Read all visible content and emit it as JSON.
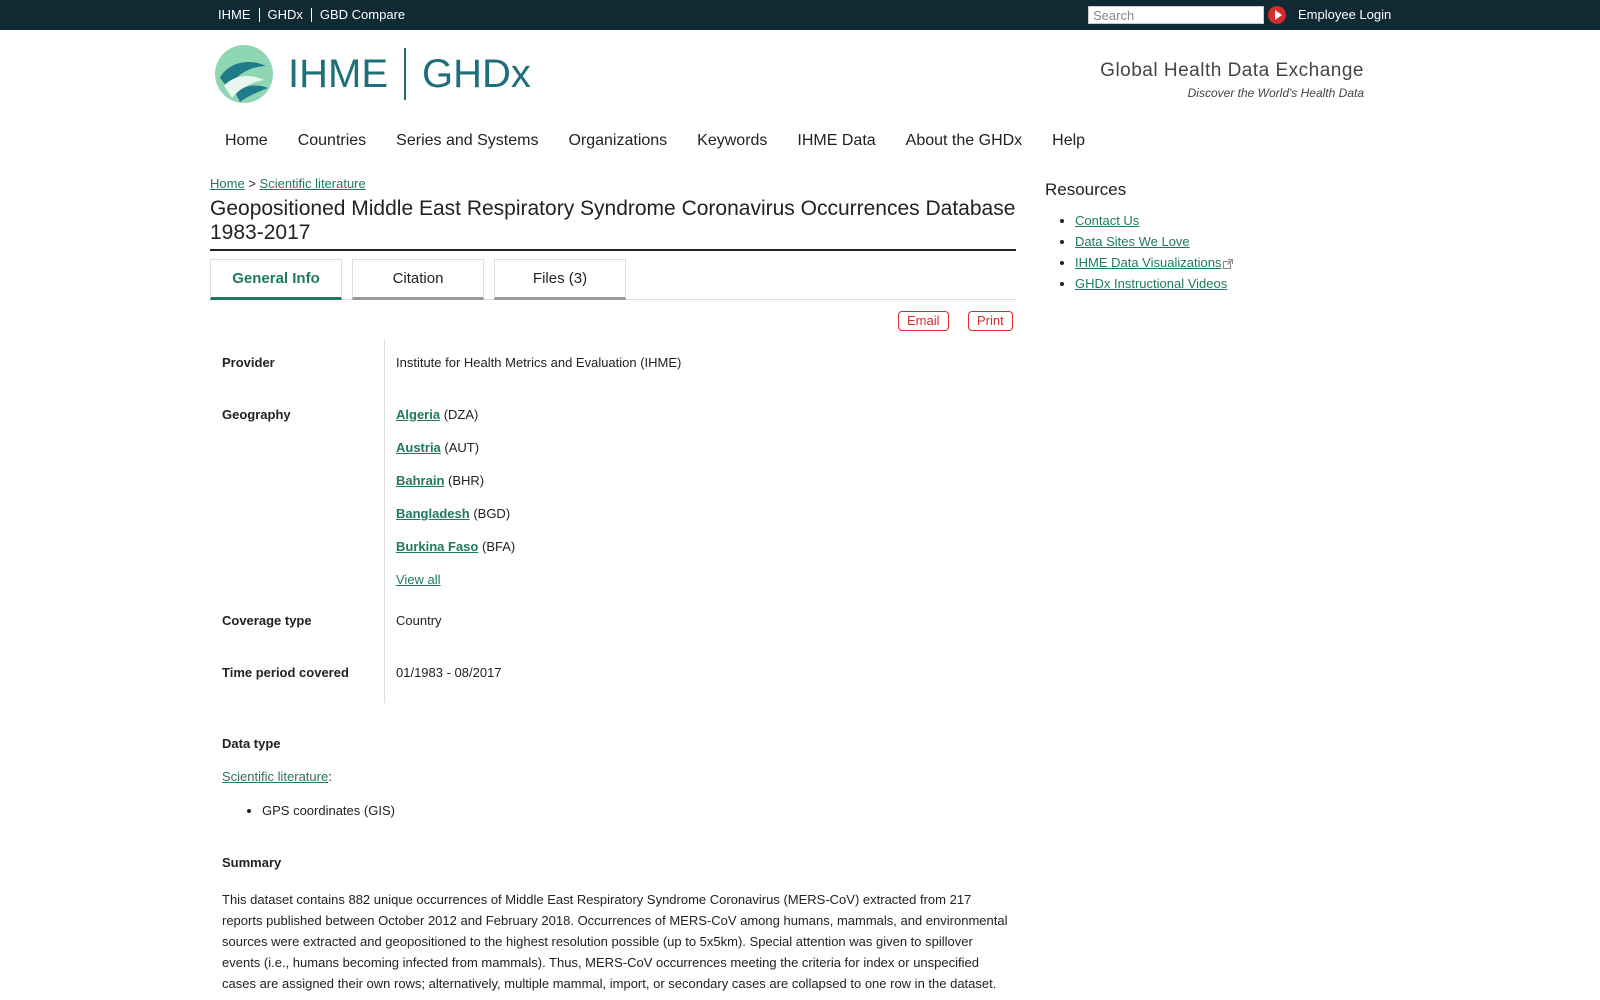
{
  "topnav": [
    "IHME",
    "GHDx",
    "GBD Compare"
  ],
  "search": {
    "placeholder": "Search"
  },
  "login_label": "Employee Login",
  "brand": {
    "ihme": "IHME",
    "ghdx": "GHDx",
    "tagline": "Global Health Data Exchange",
    "subtagline": "Discover the World's Health Data"
  },
  "mainnav": [
    "Home",
    "Countries",
    "Series and Systems",
    "Organizations",
    "Keywords",
    "IHME Data",
    "About the GHDx",
    "Help"
  ],
  "breadcrumb": {
    "home": "Home",
    "sep": ">",
    "current": "Scientific literature"
  },
  "title": "Geopositioned Middle East Respiratory Syndrome Coronavirus Occurrences Database 1983-2017",
  "tabs": [
    "General Info",
    "Citation",
    "Files (3)"
  ],
  "actions": {
    "email": "Email",
    "print": "Print"
  },
  "provider": {
    "label": "Provider",
    "value": "Institute for Health Metrics and Evaluation (IHME)"
  },
  "geography": {
    "label": "Geography",
    "items": [
      {
        "name": "Algeria",
        "code": "(DZA)"
      },
      {
        "name": "Austria",
        "code": "(AUT)"
      },
      {
        "name": "Bahrain",
        "code": "(BHR)"
      },
      {
        "name": "Bangladesh",
        "code": "(BGD)"
      },
      {
        "name": "Burkina Faso",
        "code": "(BFA)"
      }
    ],
    "view_all": "View all"
  },
  "coverage": {
    "label": "Coverage type",
    "value": "Country"
  },
  "time_period": {
    "label": "Time period covered",
    "value": "01/1983 - 08/2017"
  },
  "data_type": {
    "label": "Data type",
    "link": "Scientific literature",
    "colon": ":",
    "item": "GPS coordinates (GIS)"
  },
  "summary": {
    "label": "Summary",
    "text": "This dataset contains 882 unique occurrences of Middle East Respiratory Syndrome Coronavirus (MERS-CoV) extracted from 217 reports published between October 2012 and February 2018. Occurrences of MERS-CoV among humans, mammals, and environmental sources were extracted and geopositioned to the highest resolution possible (up to 5x5km). Special attention was given to spillover events (i.e., humans becoming infected from mammals). Thus, MERS-CoV occurrences meeting the criteria for index or unspecified cases are assigned their own rows; alternatively, multiple mammal, import, or secondary cases are collapsed to one row in the dataset."
  },
  "resources": {
    "title": "Resources",
    "items": [
      "Contact Us",
      "Data Sites We Love",
      "IHME Data Visualizations",
      "GHDx Instructional Videos"
    ]
  },
  "colors": {
    "topbar": "#0f2a33",
    "accent": "#1f7a5c",
    "button": "#d62b2b"
  }
}
